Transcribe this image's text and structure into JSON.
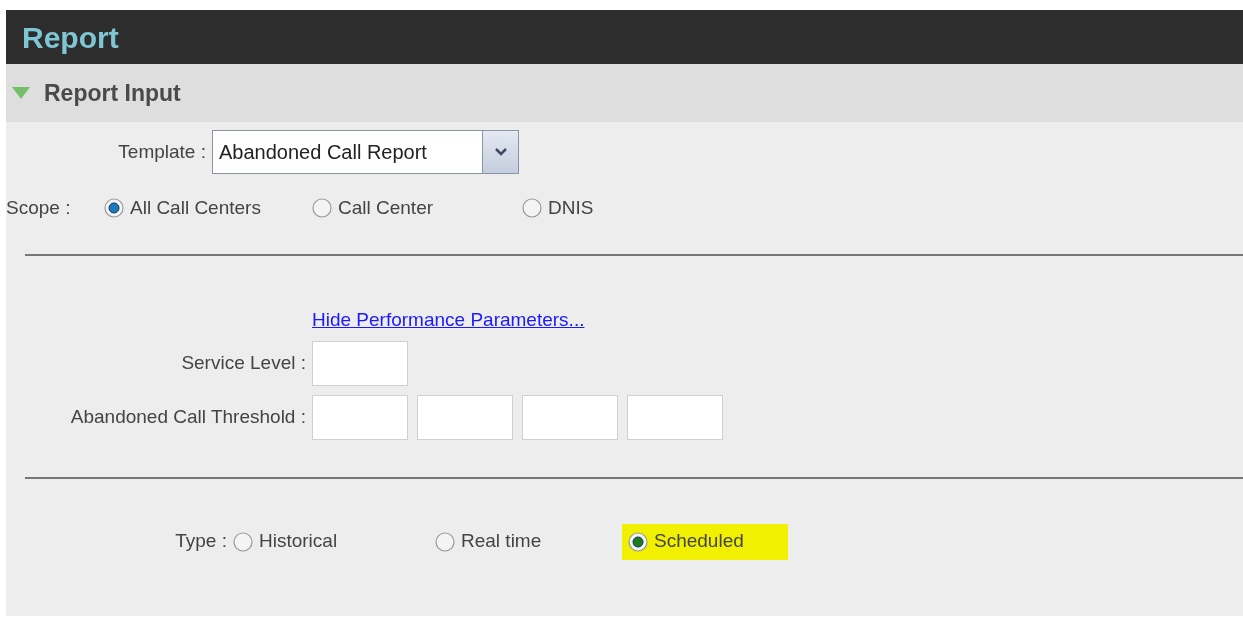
{
  "header": {
    "title": "Report"
  },
  "section": {
    "title": "Report Input",
    "expanded": true
  },
  "template": {
    "label": "Template :",
    "value": "Abandoned Call Report"
  },
  "scope": {
    "label": "Scope :",
    "options": [
      {
        "label": "All Call Centers",
        "selected": true
      },
      {
        "label": "Call Center",
        "selected": false
      },
      {
        "label": "DNIS",
        "selected": false
      }
    ]
  },
  "performance_link": "Hide Performance Parameters...",
  "service_level": {
    "label": "Service Level :"
  },
  "threshold": {
    "label": "Abandoned Call Threshold :"
  },
  "type": {
    "label": "Type :",
    "options": [
      {
        "label": "Historical",
        "selected": false,
        "highlighted": false
      },
      {
        "label": "Real time",
        "selected": false,
        "highlighted": false
      },
      {
        "label": "Scheduled",
        "selected": true,
        "highlighted": true
      }
    ]
  }
}
